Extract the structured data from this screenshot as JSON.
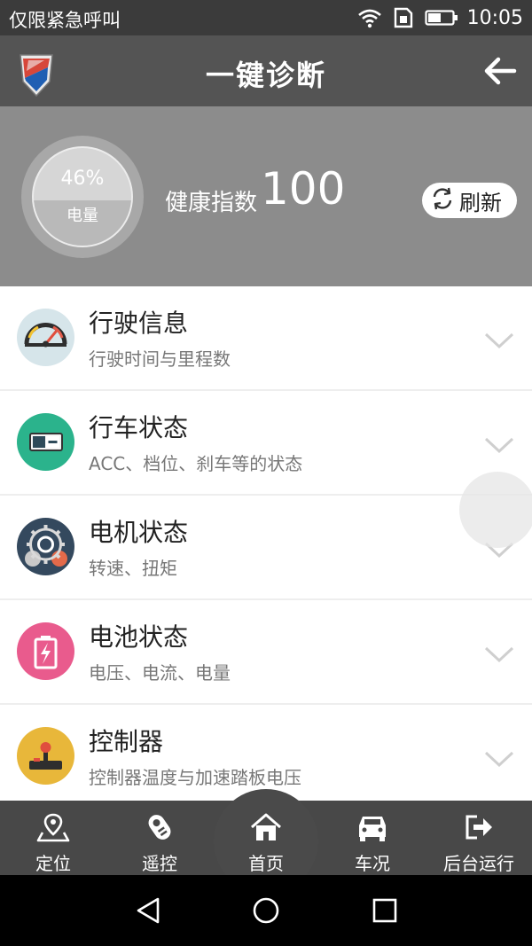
{
  "status_bar": {
    "carrier": "仅限紧急呼叫",
    "time": "10:05",
    "icons": [
      "wifi-icon",
      "sim-icon",
      "battery-icon"
    ]
  },
  "header": {
    "title": "一键诊断",
    "logo_icon": "app-logo-icon",
    "back_icon": "back-arrow-icon"
  },
  "summary": {
    "battery_percent_text": "46%",
    "battery_fraction": 0.46,
    "battery_label": "电量",
    "health_label": "健康指数",
    "health_value": "100",
    "refresh_label": "刷新",
    "refresh_icon": "refresh-icon"
  },
  "items": [
    {
      "title": "行驶信息",
      "subtitle": "行驶时间与里程数",
      "icon": "speedometer-icon",
      "color": "#d6e5ea"
    },
    {
      "title": "行车状态",
      "subtitle": "ACC、档位、刹车等的状态",
      "icon": "switch-on-icon",
      "color": "#2bb38c"
    },
    {
      "title": "电机状态",
      "subtitle": "转速、扭矩",
      "icon": "gears-icon",
      "color": "#34495e"
    },
    {
      "title": "电池状态",
      "subtitle": "电压、电流、电量",
      "icon": "battery-charge-icon",
      "color": "#e95b8d"
    },
    {
      "title": "控制器",
      "subtitle": "控制器温度与加速踏板电压",
      "icon": "joystick-icon",
      "color": "#e8b73a"
    }
  ],
  "bottom_nav": [
    {
      "label": "定位",
      "icon": "location-icon"
    },
    {
      "label": "遥控",
      "icon": "remote-icon"
    },
    {
      "label": "首页",
      "icon": "home-icon"
    },
    {
      "label": "车况",
      "icon": "car-icon"
    },
    {
      "label": "后台运行",
      "icon": "exit-icon"
    }
  ],
  "system_nav": [
    "back-triangle-icon",
    "home-circle-icon",
    "recents-square-icon"
  ]
}
